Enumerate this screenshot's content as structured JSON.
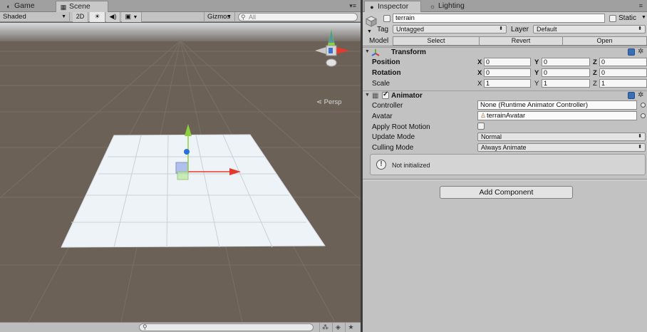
{
  "scene_panel": {
    "tabs": [
      {
        "label": "Game",
        "icon": "pacman-icon"
      },
      {
        "label": "Scene",
        "icon": "grid-icon"
      }
    ],
    "toolbar": {
      "shading_mode": "Shaded",
      "mode_2d": "2D",
      "gizmos": "Gizmos",
      "search_placeholder": "All"
    },
    "viewport": {
      "projection_label": "Persp",
      "colors": {
        "ground": "#6b6157",
        "sky": "#d4d7da",
        "plane": "#eef3f8",
        "x_axis": "#e33a2b",
        "y_axis": "#8bd13a",
        "z_axis": "#2c6fd8"
      }
    }
  },
  "inspector": {
    "tabs": [
      {
        "label": "Inspector",
        "icon": "info-icon"
      },
      {
        "label": "Lighting",
        "icon": "lightbulb-icon"
      }
    ],
    "object_name": "terrain",
    "static_label": "Static",
    "tag_label": "Tag",
    "tag_value": "Untagged",
    "layer_label": "Layer",
    "layer_value": "Default",
    "model_label": "Model",
    "model_buttons": [
      "Select",
      "Revert",
      "Open"
    ],
    "transform": {
      "title": "Transform",
      "position": {
        "label": "Position",
        "x": "0",
        "y": "0",
        "z": "0"
      },
      "rotation": {
        "label": "Rotation",
        "x": "0",
        "y": "0",
        "z": "0"
      },
      "scale": {
        "label": "Scale",
        "x": "1",
        "y": "1",
        "z": "1"
      },
      "axis_x": "X",
      "axis_y": "Y",
      "axis_z": "Z"
    },
    "animator": {
      "title": "Animator",
      "controller_label": "Controller",
      "controller_value": "None (Runtime Animator Controller)",
      "avatar_label": "Avatar",
      "avatar_value": "terrainAvatar",
      "apply_root_motion_label": "Apply Root Motion",
      "update_mode_label": "Update Mode",
      "update_mode_value": "Normal",
      "culling_mode_label": "Culling Mode",
      "culling_mode_value": "Always Animate",
      "help_message": "Not initialized"
    },
    "add_component": "Add Component"
  }
}
